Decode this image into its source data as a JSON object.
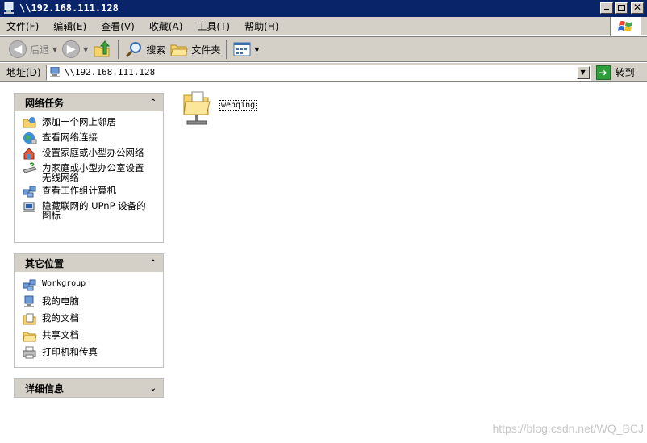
{
  "window": {
    "title": "\\\\192.168.111.128"
  },
  "menu": {
    "items": [
      "文件(F)",
      "编辑(E)",
      "查看(V)",
      "收藏(A)",
      "工具(T)",
      "帮助(H)"
    ]
  },
  "toolbar": {
    "back": "后退",
    "search": "搜索",
    "folders": "文件夹"
  },
  "address": {
    "label": "地址(D)",
    "value": "\\\\192.168.111.128",
    "go": "转到"
  },
  "network_tasks": {
    "title": "网络任务",
    "items": [
      "添加一个网上邻居",
      "查看网络连接",
      "设置家庭或小型办公网络",
      "为家庭或小型办公室设置无线网络",
      "查看工作组计算机",
      "隐藏联网的 UPnP 设备的图标"
    ]
  },
  "other_places": {
    "title": "其它位置",
    "items": [
      "Workgroup",
      "我的电脑",
      "我的文档",
      "共享文档",
      "打印机和传真"
    ]
  },
  "details": {
    "title": "详细信息"
  },
  "shares": [
    {
      "name": "wenqing"
    }
  ],
  "watermark": "https://blog.csdn.net/WQ_BCJ"
}
